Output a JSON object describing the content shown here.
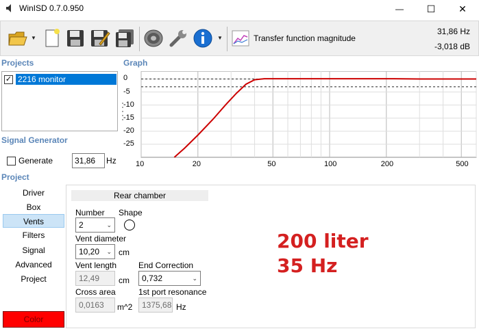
{
  "window": {
    "title": "WinISD 0.7.0.950",
    "minimize_glyph": "—",
    "maximize_glyph": "☐",
    "close_glyph": "✕"
  },
  "toolbar": {
    "graph_select_label": "Transfer function magnitude",
    "readout_freq": "31,86 Hz",
    "readout_db": "-3,018 dB",
    "dropdown_glyph": "▼",
    "icons": [
      "open-folder-icon",
      "new-document-icon",
      "save-icon",
      "save-as-icon",
      "save-all-icon",
      "speaker-icon",
      "wrench-icon",
      "info-icon",
      "graph-icon"
    ]
  },
  "sections": {
    "projects": "Projects",
    "graph": "Graph",
    "signal_generator": "Signal Generator",
    "project": "Project"
  },
  "projects": {
    "items": [
      {
        "name": "2216 monitor",
        "checked": true
      }
    ]
  },
  "graph": {
    "y_ticks": [
      "0",
      "-5",
      "-10",
      "-15",
      "-20",
      "-25"
    ],
    "x_ticks": [
      "10",
      "20",
      "50",
      "100",
      "200",
      "500"
    ],
    "curve_color": "#cc0000"
  },
  "chart_data": {
    "type": "line",
    "xlabel": "",
    "ylabel": "",
    "x_scale": "log",
    "xlim": [
      10,
      600
    ],
    "ylim": [
      -30,
      3
    ],
    "grid": true,
    "reference_lines_db": [
      0,
      -3
    ],
    "series": [
      {
        "x": [
          15,
          17,
          20,
          24,
          28,
          32,
          36,
          40,
          45,
          50,
          60,
          80,
          100,
          150,
          200,
          220,
          300,
          400,
          500,
          600
        ],
        "y": [
          -30,
          -26.5,
          -21.5,
          -15.5,
          -10,
          -5.5,
          -2,
          -0.3,
          0.1,
          0.1,
          0.1,
          0.1,
          0.1,
          0.1,
          0.1,
          0.1,
          0,
          0,
          0,
          0
        ]
      }
    ]
  },
  "signal_generator": {
    "generate_label": "Generate",
    "generate_checked": false,
    "frequency_value": "31,86",
    "frequency_unit": "Hz"
  },
  "project_nav": {
    "items": [
      "Driver",
      "Box",
      "Vents",
      "Filters",
      "Signal",
      "Advanced",
      "Project"
    ],
    "selected": "Vents",
    "color_button_label": "Color"
  },
  "vents_panel": {
    "header": "Rear chamber",
    "number_label": "Number",
    "number_value": "2",
    "shape_label": "Shape",
    "vent_diameter_label": "Vent diameter",
    "vent_diameter_value": "10,20",
    "vent_diameter_unit": "cm",
    "vent_length_label": "Vent length",
    "vent_length_value": "12,49",
    "vent_length_unit": "cm",
    "end_correction_label": "End Correction",
    "end_correction_value": "0,732",
    "cross_area_label": "Cross area",
    "cross_area_value": "0,0163",
    "cross_area_unit": "m^2",
    "port_resonance_label": "1st port resonance",
    "port_resonance_value": "1375,68",
    "port_resonance_unit": "Hz",
    "annotation_line1": "200 liter",
    "annotation_line2": "35 Hz",
    "annotation_color": "#d42020"
  }
}
